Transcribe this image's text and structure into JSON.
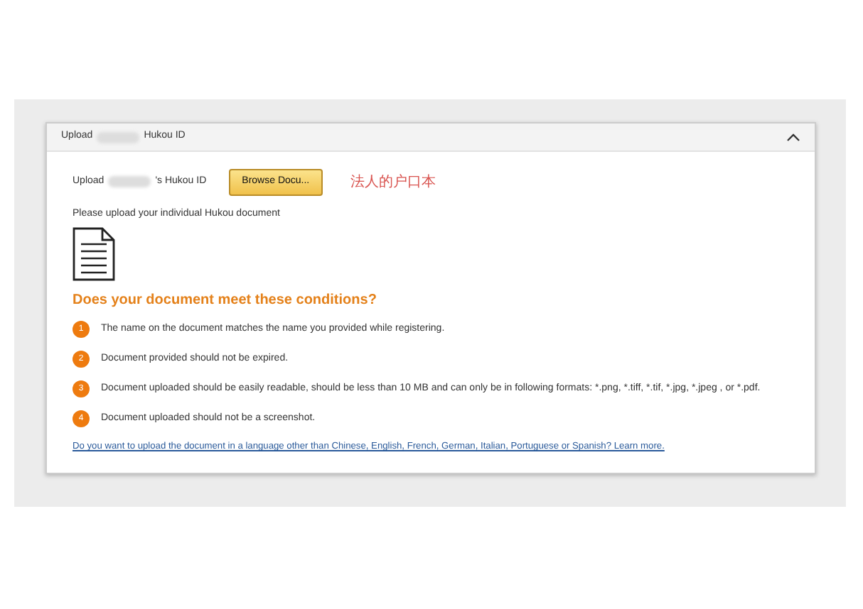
{
  "panel": {
    "title_start": "Upload",
    "title_end": "Hukou ID",
    "expanded": true
  },
  "upload": {
    "label_start": "Upload",
    "label_end": "'s Hukou ID",
    "button": "Browse Docu...",
    "annotation": "法人的户口本"
  },
  "instruction": "Please upload your individual Hukou document",
  "heading": "Does your document meet these conditions?",
  "conditions": [
    {
      "number": "1",
      "text": "The name on the document matches the name you provided while registering."
    },
    {
      "number": "2",
      "text": "Document provided should not be expired."
    },
    {
      "number": "3",
      "text": "Document uploaded should be easily readable, should be less than 10 MB and can only be in following formats: *.png, *.tiff, *.tif, *.jpg, *.jpeg , or *.pdf."
    },
    {
      "number": "4",
      "text": "Document uploaded should not be a screenshot."
    }
  ],
  "language_link": "Do you want to upload the document in a language other than Chinese, English, French, German, Italian, Portuguese or Spanish? Learn more."
}
